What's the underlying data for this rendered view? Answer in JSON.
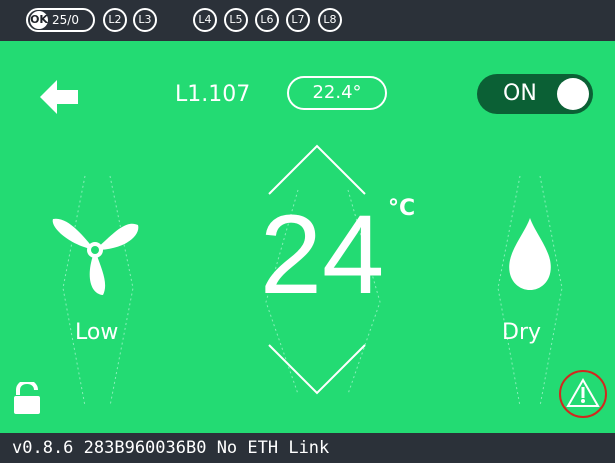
{
  "status_bar": {
    "ok_badge": "OK",
    "ok_value": "25/0",
    "loads": [
      "L2",
      "L3",
      "L4",
      "L5",
      "L6",
      "L7",
      "L8"
    ]
  },
  "header": {
    "room": "L1.107",
    "current_temp": "22.4°",
    "power": "ON"
  },
  "main": {
    "setpoint": "24",
    "unit": "°C",
    "fan_label": "Low",
    "mode_label": "Dry"
  },
  "footer": {
    "status_text": "v0.8.6 283B960036B0 No ETH Link"
  },
  "colors": {
    "background": "#23db73",
    "bars": "#2b3139",
    "toggle_on": "#0b6035",
    "alert_ring": "#d2281e"
  },
  "icons": [
    "back-arrow-icon",
    "fan-icon",
    "droplet-icon",
    "unlock-icon",
    "alert-icon",
    "chevron-up-icon",
    "chevron-down-icon"
  ]
}
